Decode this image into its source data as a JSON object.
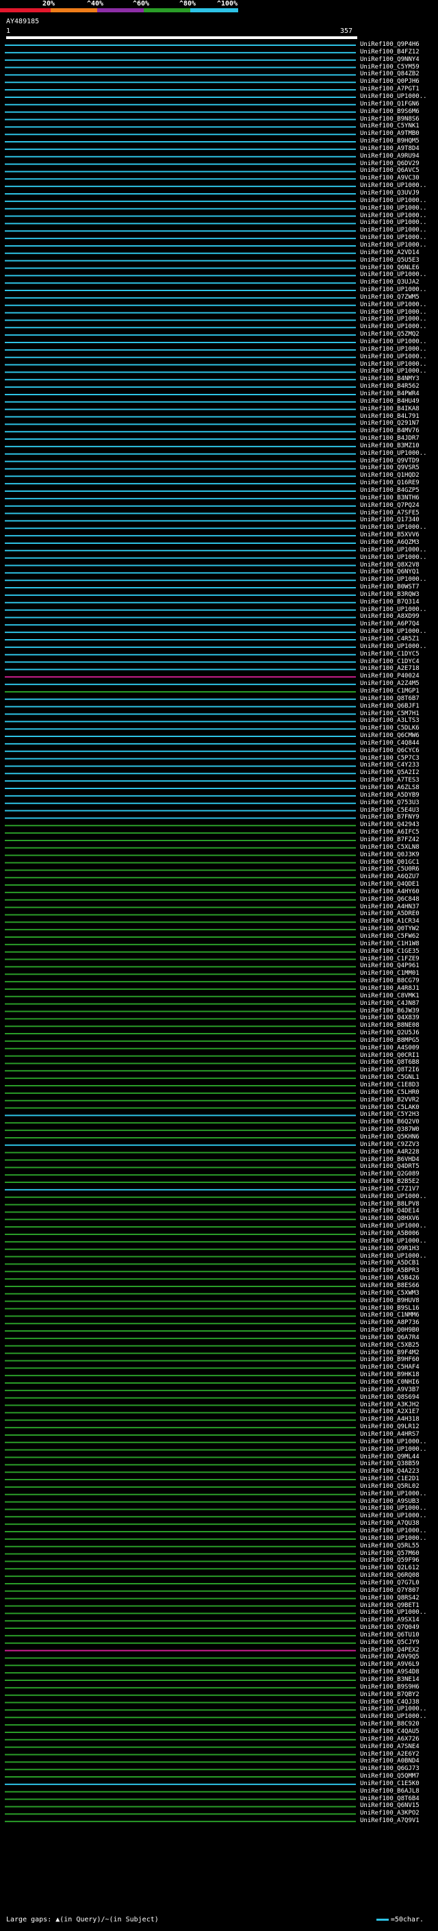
{
  "legend": {
    "ticks": [
      "20%",
      "^40%",
      "^60%",
      "^80%",
      "^100%"
    ],
    "colors": [
      "#e3182d",
      "#ef7d1a",
      "#8d2ea6",
      "#2a9d28",
      "#2ec3e6"
    ]
  },
  "query": {
    "id": "AY489185",
    "start": "1",
    "end": "357"
  },
  "colors": {
    "cyan": "#2ec3e6",
    "green": "#2a9d28",
    "magenta": "#cc1f8f",
    "white": "#ffffff"
  },
  "footer": {
    "gaps_text": "Large gaps: ▲(in Query)/~(in Subject)",
    "scale_text": "=50char."
  },
  "hits": [
    {
      "label": "UniRef100_Q9P4H6",
      "color": "cyan"
    },
    {
      "label": "UniRef100_B4FZ12",
      "color": "cyan"
    },
    {
      "label": "UniRef100_Q9NNY4",
      "color": "cyan"
    },
    {
      "label": "UniRef100_C5YM59",
      "color": "cyan"
    },
    {
      "label": "UniRef100_Q84ZB2",
      "color": "cyan"
    },
    {
      "label": "UniRef100_Q0PJH6",
      "color": "cyan"
    },
    {
      "label": "UniRef100_A7PGT1",
      "color": "cyan"
    },
    {
      "label": "UniRef100_UP1000..",
      "color": "cyan"
    },
    {
      "label": "UniRef100_Q1FGN6",
      "color": "cyan"
    },
    {
      "label": "UniRef100_B9S6M6",
      "color": "cyan"
    },
    {
      "label": "UniRef100_B9N8S6",
      "color": "cyan"
    },
    {
      "label": "UniRef100_C5YNK1",
      "color": "cyan"
    },
    {
      "label": "UniRef100_A9TMB0",
      "color": "cyan"
    },
    {
      "label": "UniRef100_B9HQM5",
      "color": "cyan"
    },
    {
      "label": "UniRef100_A9T8D4",
      "color": "cyan"
    },
    {
      "label": "UniRef100_A9RU94",
      "color": "cyan"
    },
    {
      "label": "UniRef100_Q6DV29",
      "color": "cyan"
    },
    {
      "label": "UniRef100_Q6AVC5",
      "color": "cyan"
    },
    {
      "label": "UniRef100_A9VC30",
      "color": "cyan"
    },
    {
      "label": "UniRef100_UP1000..",
      "color": "cyan"
    },
    {
      "label": "UniRef100_Q3UVJ9",
      "color": "cyan"
    },
    {
      "label": "UniRef100_UP1000..",
      "color": "cyan"
    },
    {
      "label": "UniRef100_UP1000..",
      "color": "cyan"
    },
    {
      "label": "UniRef100_UP1000..",
      "color": "cyan"
    },
    {
      "label": "UniRef100_UP1000..",
      "color": "cyan"
    },
    {
      "label": "UniRef100_UP1000..",
      "color": "cyan"
    },
    {
      "label": "UniRef100_UP1000..",
      "color": "cyan"
    },
    {
      "label": "UniRef100_UP1000..",
      "color": "cyan"
    },
    {
      "label": "UniRef100_A2VD14",
      "color": "cyan"
    },
    {
      "label": "UniRef100_Q5U5E3",
      "color": "cyan"
    },
    {
      "label": "UniRef100_Q6NLE6",
      "color": "cyan"
    },
    {
      "label": "UniRef100_UP1000..",
      "color": "cyan"
    },
    {
      "label": "UniRef100_Q3UJA2",
      "color": "cyan"
    },
    {
      "label": "UniRef100_UP1000..",
      "color": "cyan"
    },
    {
      "label": "UniRef100_Q7ZWM5",
      "color": "cyan"
    },
    {
      "label": "UniRef100_UP1000..",
      "color": "cyan"
    },
    {
      "label": "UniRef100_UP1000..",
      "color": "cyan"
    },
    {
      "label": "UniRef100_UP1000..",
      "color": "cyan"
    },
    {
      "label": "UniRef100_UP1000..",
      "color": "cyan"
    },
    {
      "label": "UniRef100_Q5ZMQ2",
      "color": "cyan"
    },
    {
      "label": "UniRef100_UP1000..",
      "color": "cyan"
    },
    {
      "label": "UniRef100_UP1000..",
      "color": "cyan"
    },
    {
      "label": "UniRef100_UP1000..",
      "color": "cyan"
    },
    {
      "label": "UniRef100_UP1000..",
      "color": "cyan"
    },
    {
      "label": "UniRef100_UP1000..",
      "color": "cyan"
    },
    {
      "label": "UniRef100_B4NMY3",
      "color": "cyan"
    },
    {
      "label": "UniRef100_B4R562",
      "color": "cyan"
    },
    {
      "label": "UniRef100_B4PWR4",
      "color": "cyan"
    },
    {
      "label": "UniRef100_B4HU49",
      "color": "cyan"
    },
    {
      "label": "UniRef100_B4IKA8",
      "color": "cyan"
    },
    {
      "label": "UniRef100_B4L791",
      "color": "cyan"
    },
    {
      "label": "UniRef100_Q291N7",
      "color": "cyan"
    },
    {
      "label": "UniRef100_B4MV76",
      "color": "cyan"
    },
    {
      "label": "UniRef100_B4JDR7",
      "color": "cyan"
    },
    {
      "label": "UniRef100_B3MZ10",
      "color": "cyan"
    },
    {
      "label": "UniRef100_UP1000..",
      "color": "cyan"
    },
    {
      "label": "UniRef100_Q9VTD9",
      "color": "cyan"
    },
    {
      "label": "UniRef100_Q9VSR5",
      "color": "cyan"
    },
    {
      "label": "UniRef100_Q1HQD2",
      "color": "cyan"
    },
    {
      "label": "UniRef100_Q16RE9",
      "color": "cyan"
    },
    {
      "label": "UniRef100_B4GZP5",
      "color": "cyan"
    },
    {
      "label": "UniRef100_B3NTH6",
      "color": "cyan"
    },
    {
      "label": "UniRef100_Q7PQ24",
      "color": "cyan"
    },
    {
      "label": "UniRef100_A7SFE5",
      "color": "cyan"
    },
    {
      "label": "UniRef100_Q17340",
      "color": "cyan"
    },
    {
      "label": "UniRef100_UP1000..",
      "color": "cyan"
    },
    {
      "label": "UniRef100_B5XVV6",
      "color": "cyan"
    },
    {
      "label": "UniRef100_A6QZM3",
      "color": "cyan"
    },
    {
      "label": "UniRef100_UP1000..",
      "color": "cyan"
    },
    {
      "label": "UniRef100_UP1000..",
      "color": "cyan"
    },
    {
      "label": "UniRef100_Q8X2V8",
      "color": "cyan"
    },
    {
      "label": "UniRef100_Q6NYQ1",
      "color": "cyan"
    },
    {
      "label": "UniRef100_UP1000..",
      "color": "cyan"
    },
    {
      "label": "UniRef100_B0WST7",
      "color": "cyan"
    },
    {
      "label": "UniRef100_B3RQW3",
      "color": "cyan"
    },
    {
      "label": "UniRef100_B7Q314",
      "color": "cyan"
    },
    {
      "label": "UniRef100_UP1000..",
      "color": "cyan"
    },
    {
      "label": "UniRef100_A8XD99",
      "color": "cyan"
    },
    {
      "label": "UniRef100_A6P7Q4",
      "color": "cyan"
    },
    {
      "label": "UniRef100_UP1000..",
      "color": "cyan"
    },
    {
      "label": "UniRef100_C4R5Z1",
      "color": "cyan"
    },
    {
      "label": "UniRef100_UP1000..",
      "color": "cyan"
    },
    {
      "label": "UniRef100_C1DYC5",
      "color": "cyan"
    },
    {
      "label": "UniRef100_C1DYC4",
      "color": "cyan"
    },
    {
      "label": "UniRef100_A2E718",
      "color": "cyan"
    },
    {
      "label": "UniRef100_P40024",
      "color": "magenta"
    },
    {
      "label": "UniRef100_A2Z4M5",
      "color": "cyan"
    },
    {
      "label": "UniRef100_C1MGP1",
      "color": "green"
    },
    {
      "label": "UniRef100_Q8T6B7",
      "color": "cyan"
    },
    {
      "label": "UniRef100_Q6BJF1",
      "color": "cyan"
    },
    {
      "label": "UniRef100_C5M7H1",
      "color": "cyan"
    },
    {
      "label": "UniRef100_A3LTS3",
      "color": "cyan"
    },
    {
      "label": "UniRef100_C5DLK6",
      "color": "cyan"
    },
    {
      "label": "UniRef100_Q6CMW6",
      "color": "cyan"
    },
    {
      "label": "UniRef100_C4Q844",
      "color": "cyan"
    },
    {
      "label": "UniRef100_Q6CYC6",
      "color": "cyan"
    },
    {
      "label": "UniRef100_C5P7C3",
      "color": "cyan"
    },
    {
      "label": "UniRef100_C4Y233",
      "color": "cyan"
    },
    {
      "label": "UniRef100_Q5A2I2",
      "color": "cyan"
    },
    {
      "label": "UniRef100_A7TES3",
      "color": "cyan"
    },
    {
      "label": "UniRef100_A6ZLS8",
      "color": "cyan"
    },
    {
      "label": "UniRef100_A5DYB9",
      "color": "cyan"
    },
    {
      "label": "UniRef100_Q753U3",
      "color": "cyan"
    },
    {
      "label": "UniRef100_C5E4U3",
      "color": "cyan"
    },
    {
      "label": "UniRef100_B7FNY9",
      "color": "cyan"
    },
    {
      "label": "UniRef100_Q42943",
      "color": "green"
    },
    {
      "label": "UniRef100_A6IFC5",
      "color": "green"
    },
    {
      "label": "UniRef100_B7FZ42",
      "color": "green"
    },
    {
      "label": "UniRef100_C5XLN8",
      "color": "green"
    },
    {
      "label": "UniRef100_Q0J3K9",
      "color": "green"
    },
    {
      "label": "UniRef100_Q01GC1",
      "color": "green"
    },
    {
      "label": "UniRef100_C5U0R6",
      "color": "green"
    },
    {
      "label": "UniRef100_A6QZU7",
      "color": "green"
    },
    {
      "label": "UniRef100_Q4QDE1",
      "color": "green"
    },
    {
      "label": "UniRef100_A4HY60",
      "color": "green"
    },
    {
      "label": "UniRef100_Q6C848",
      "color": "green"
    },
    {
      "label": "UniRef100_A4HN37",
      "color": "green"
    },
    {
      "label": "UniRef100_A5DRE0",
      "color": "green"
    },
    {
      "label": "UniRef100_A1CR34",
      "color": "green"
    },
    {
      "label": "UniRef100_Q0TYW2",
      "color": "green"
    },
    {
      "label": "UniRef100_C5FW62",
      "color": "green"
    },
    {
      "label": "UniRef100_C1H1W8",
      "color": "green"
    },
    {
      "label": "UniRef100_C1GE35",
      "color": "green"
    },
    {
      "label": "UniRef100_C1FZE9",
      "color": "green"
    },
    {
      "label": "UniRef100_Q4P961",
      "color": "green"
    },
    {
      "label": "UniRef100_C1MM01",
      "color": "green"
    },
    {
      "label": "UniRef100_B8CG79",
      "color": "green"
    },
    {
      "label": "UniRef100_A4R8J1",
      "color": "green"
    },
    {
      "label": "UniRef100_C8VMK1",
      "color": "green"
    },
    {
      "label": "UniRef100_C4JN87",
      "color": "green"
    },
    {
      "label": "UniRef100_B6JW39",
      "color": "green"
    },
    {
      "label": "UniRef100_Q4X839",
      "color": "green"
    },
    {
      "label": "UniRef100_B8NE08",
      "color": "green"
    },
    {
      "label": "UniRef100_Q2U5J6",
      "color": "green"
    },
    {
      "label": "UniRef100_B8MPG5",
      "color": "green"
    },
    {
      "label": "UniRef100_A4S009",
      "color": "green"
    },
    {
      "label": "UniRef100_Q0CRI1",
      "color": "green"
    },
    {
      "label": "UniRef100_Q8T6B8",
      "color": "green"
    },
    {
      "label": "UniRef100_Q8T2I6",
      "color": "green"
    },
    {
      "label": "UniRef100_C5GNL1",
      "color": "green"
    },
    {
      "label": "UniRef100_C1E8D3",
      "color": "green"
    },
    {
      "label": "UniRef100_C5LHR0",
      "color": "green"
    },
    {
      "label": "UniRef100_B2VVR2",
      "color": "green"
    },
    {
      "label": "UniRef100_C5LAK0",
      "color": "green"
    },
    {
      "label": "UniRef100_C5Y2H3",
      "color": "cyan"
    },
    {
      "label": "UniRef100_B6Q2V0",
      "color": "green"
    },
    {
      "label": "UniRef100_Q387W0",
      "color": "green"
    },
    {
      "label": "UniRef100_Q5KHN6",
      "color": "green"
    },
    {
      "label": "UniRef100_C9ZZV3",
      "color": "cyan"
    },
    {
      "label": "UniRef100_A4R228",
      "color": "green"
    },
    {
      "label": "UniRef100_B6VHD4",
      "color": "green"
    },
    {
      "label": "UniRef100_Q4DRT5",
      "color": "green"
    },
    {
      "label": "UniRef100_Q2G089",
      "color": "green"
    },
    {
      "label": "UniRef100_B2B5E2",
      "color": "green"
    },
    {
      "label": "UniRef100_C7Z1V7",
      "color": "cyan"
    },
    {
      "label": "UniRef100_UP1000..",
      "color": "green"
    },
    {
      "label": "UniRef100_B8LPV8",
      "color": "green"
    },
    {
      "label": "UniRef100_Q4DE14",
      "color": "green"
    },
    {
      "label": "UniRef100_Q8HXV6",
      "color": "green"
    },
    {
      "label": "UniRef100_UP1000..",
      "color": "green"
    },
    {
      "label": "UniRef100_A5B006",
      "color": "green"
    },
    {
      "label": "UniRef100_UP1000..",
      "color": "green"
    },
    {
      "label": "UniRef100_Q9R1H3",
      "color": "green"
    },
    {
      "label": "UniRef100_UP1000..",
      "color": "green"
    },
    {
      "label": "UniRef100_A5DCB1",
      "color": "green"
    },
    {
      "label": "UniRef100_A5BPR3",
      "color": "green"
    },
    {
      "label": "UniRef100_A5B426",
      "color": "green"
    },
    {
      "label": "UniRef100_B8ES66",
      "color": "green"
    },
    {
      "label": "UniRef100_C5XWM3",
      "color": "green"
    },
    {
      "label": "UniRef100_B9HUV8",
      "color": "green"
    },
    {
      "label": "UniRef100_B9SL16",
      "color": "green"
    },
    {
      "label": "UniRef100_C1NMM6",
      "color": "green"
    },
    {
      "label": "UniRef100_A8P736",
      "color": "green"
    },
    {
      "label": "UniRef100_Q0H9B0",
      "color": "green"
    },
    {
      "label": "UniRef100_Q6A7R4",
      "color": "green"
    },
    {
      "label": "UniRef100_C5XB25",
      "color": "green"
    },
    {
      "label": "UniRef100_B9F4M2",
      "color": "green"
    },
    {
      "label": "UniRef100_B9HF60",
      "color": "green"
    },
    {
      "label": "UniRef100_C5HAF4",
      "color": "green"
    },
    {
      "label": "UniRef100_B9HK18",
      "color": "green"
    },
    {
      "label": "UniRef100_C0NHI6",
      "color": "green"
    },
    {
      "label": "UniRef100_A9V3B7",
      "color": "green"
    },
    {
      "label": "UniRef100_Q8S694",
      "color": "green"
    },
    {
      "label": "UniRef100_A3KJH2",
      "color": "green"
    },
    {
      "label": "UniRef100_A2X1E7",
      "color": "green"
    },
    {
      "label": "UniRef100_A4H318",
      "color": "green"
    },
    {
      "label": "UniRef100_Q9LR12",
      "color": "green"
    },
    {
      "label": "UniRef100_A4HRS7",
      "color": "green"
    },
    {
      "label": "UniRef100_UP1000..",
      "color": "green"
    },
    {
      "label": "UniRef100_UP1000..",
      "color": "green"
    },
    {
      "label": "UniRef100_Q9ML44",
      "color": "green"
    },
    {
      "label": "UniRef100_Q38B59",
      "color": "green"
    },
    {
      "label": "UniRef100_Q4A223",
      "color": "green"
    },
    {
      "label": "UniRef100_C1E2D1",
      "color": "green"
    },
    {
      "label": "UniRef100_Q5RL02",
      "color": "green"
    },
    {
      "label": "UniRef100_UP1000..",
      "color": "green"
    },
    {
      "label": "UniRef100_A9SUB3",
      "color": "green"
    },
    {
      "label": "UniRef100_UP1000..",
      "color": "green"
    },
    {
      "label": "UniRef100_UP1000..",
      "color": "green"
    },
    {
      "label": "UniRef100_A7QU38",
      "color": "green"
    },
    {
      "label": "UniRef100_UP1000..",
      "color": "green"
    },
    {
      "label": "UniRef100_UP1000..",
      "color": "green"
    },
    {
      "label": "UniRef100_Q5RL55",
      "color": "green"
    },
    {
      "label": "UniRef100_Q57M60",
      "color": "green"
    },
    {
      "label": "UniRef100_Q59F96",
      "color": "green"
    },
    {
      "label": "UniRef100_Q2L612",
      "color": "green"
    },
    {
      "label": "UniRef100_Q6RQ08",
      "color": "green"
    },
    {
      "label": "UniRef100_Q7G7L0",
      "color": "green"
    },
    {
      "label": "UniRef100_Q7Y807",
      "color": "green"
    },
    {
      "label": "UniRef100_Q8RS42",
      "color": "green"
    },
    {
      "label": "UniRef100_Q9BET1",
      "color": "green"
    },
    {
      "label": "UniRef100_UP1000..",
      "color": "green"
    },
    {
      "label": "UniRef100_A9SX14",
      "color": "green"
    },
    {
      "label": "UniRef100_Q7Q049",
      "color": "green"
    },
    {
      "label": "UniRef100_Q6TU10",
      "color": "green"
    },
    {
      "label": "UniRef100_Q5CJY9",
      "color": "green"
    },
    {
      "label": "UniRef100_Q4PEX2",
      "color": "magenta"
    },
    {
      "label": "UniRef100_A9V9Q5",
      "color": "green"
    },
    {
      "label": "UniRef100_A9V6L9",
      "color": "green"
    },
    {
      "label": "UniRef100_A9S4D8",
      "color": "green"
    },
    {
      "label": "UniRef100_B3NE14",
      "color": "green"
    },
    {
      "label": "UniRef100_B9S9H6",
      "color": "green"
    },
    {
      "label": "UniRef100_B7QBY2",
      "color": "green"
    },
    {
      "label": "UniRef100_C4QJ38",
      "color": "green"
    },
    {
      "label": "UniRef100_UP1000..",
      "color": "green"
    },
    {
      "label": "UniRef100_UP1000..",
      "color": "green"
    },
    {
      "label": "UniRef100_B8C920",
      "color": "green"
    },
    {
      "label": "UniRef100_C4QAU5",
      "color": "green"
    },
    {
      "label": "UniRef100_A6X726",
      "color": "green"
    },
    {
      "label": "UniRef100_A7SNE4",
      "color": "green"
    },
    {
      "label": "UniRef100_A2E6Y2",
      "color": "green"
    },
    {
      "label": "UniRef100_A0BND4",
      "color": "green"
    },
    {
      "label": "UniRef100_Q6GJ73",
      "color": "green"
    },
    {
      "label": "UniRef100_Q5QMM7",
      "color": "green"
    },
    {
      "label": "UniRef100_C1E5K0",
      "color": "cyan"
    },
    {
      "label": "UniRef100_B6AJL8",
      "color": "green"
    },
    {
      "label": "UniRef100_Q8T6B4",
      "color": "green"
    },
    {
      "label": "UniRef100_Q6NV15",
      "color": "green"
    },
    {
      "label": "UniRef100_A3KPO2",
      "color": "green"
    },
    {
      "label": "UniRef100_A7Q9V1",
      "color": "green"
    }
  ]
}
